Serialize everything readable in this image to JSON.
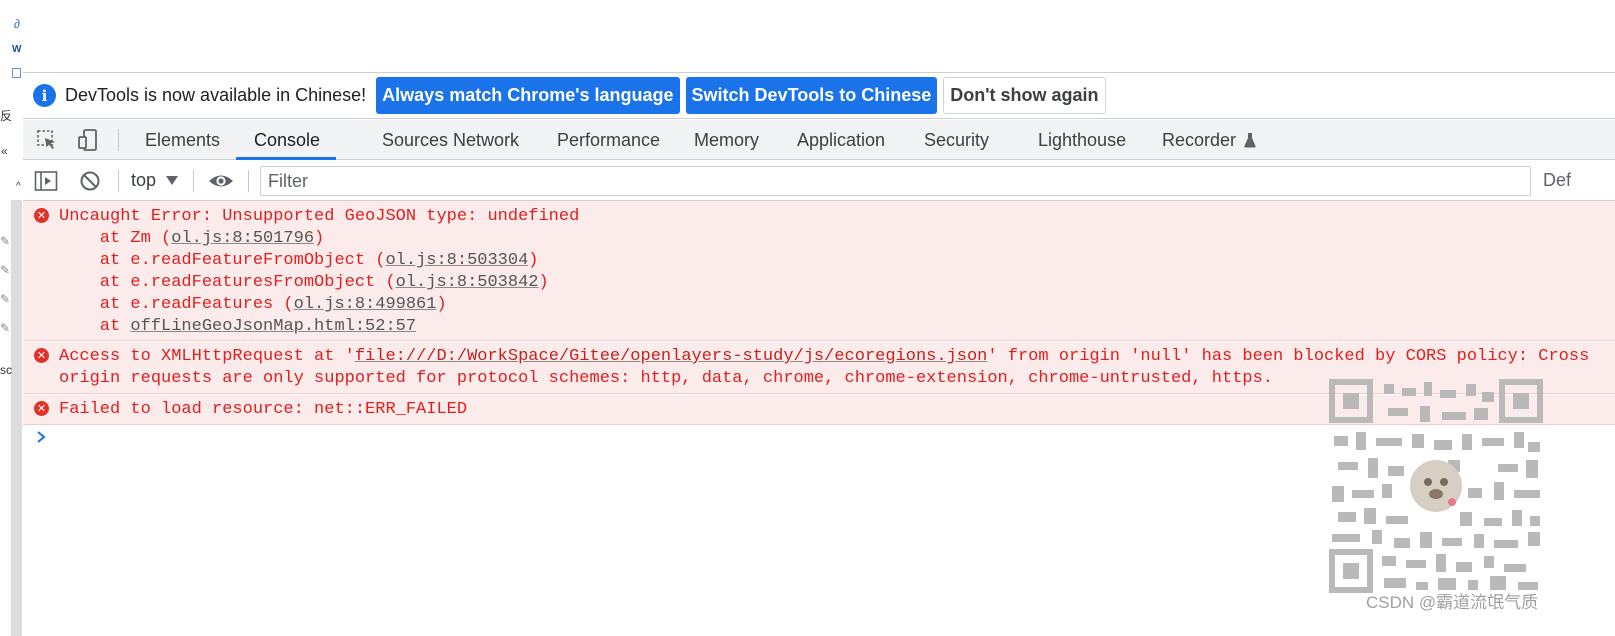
{
  "infobar": {
    "message": "DevTools is now available in Chinese!",
    "match_button": "Always match Chrome's language",
    "switch_button": "Switch DevTools to Chinese",
    "dismiss_button": "Don't show again"
  },
  "tabs": [
    {
      "label": "Elements"
    },
    {
      "label": "Console"
    },
    {
      "label": "Sources"
    },
    {
      "label": "Network"
    },
    {
      "label": "Performance"
    },
    {
      "label": "Memory"
    },
    {
      "label": "Application"
    },
    {
      "label": "Security"
    },
    {
      "label": "Lighthouse"
    },
    {
      "label": "Recorder"
    }
  ],
  "active_tab": "Console",
  "console_toolbar": {
    "context": "top",
    "filter_placeholder": "Filter",
    "default_levels_truncated": "Def"
  },
  "messages": [
    {
      "error_line": "Uncaught Error: Unsupported GeoJSON type: undefined",
      "stack": [
        {
          "prefix": "    at Zm (",
          "link": "ol.js:8:501796",
          "suffix": ")"
        },
        {
          "prefix": "    at e.readFeatureFromObject (",
          "link": "ol.js:8:503304",
          "suffix": ")"
        },
        {
          "prefix": "    at e.readFeaturesFromObject (",
          "link": "ol.js:8:503842",
          "suffix": ")"
        },
        {
          "prefix": "    at e.readFeatures (",
          "link": "ol.js:8:499861",
          "suffix": ")"
        },
        {
          "prefix": "    at ",
          "link": "offLineGeoJsonMap.html:52:57",
          "suffix": ""
        }
      ]
    },
    {
      "prefix": "Access to XMLHttpRequest at '",
      "link": "file:///D:/WorkSpace/Gitee/openlayers-study/js/ecoregions.json",
      "suffix": "' from origin 'null' has been blocked by CORS policy: Cross",
      "line2": "origin requests are only supported for protocol schemes: http, data, chrome, chrome-extension, chrome-untrusted, https."
    },
    {
      "text": "Failed to load resource: net::ERR_FAILED"
    }
  ],
  "left_strip": {
    "frag1": "反",
    "frag2": "«",
    "frag3": "sc"
  },
  "watermark": "CSDN @霸道流氓气质",
  "colors": {
    "accent": "#1a73e8",
    "error_text": "#e02020",
    "error_bg": "#fcebeb"
  }
}
